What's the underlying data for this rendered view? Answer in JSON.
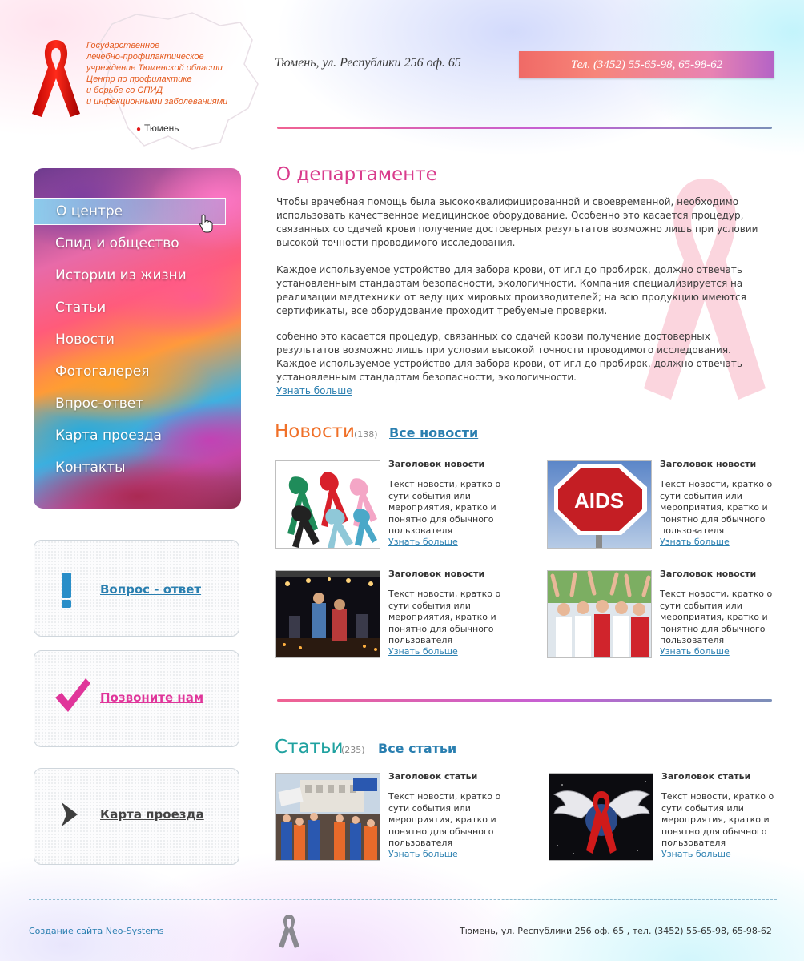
{
  "header": {
    "org_name": "Государственное\nлечебно-профилактическое\nучреждение Тюменской области\nЦентр по профилактике\nи борьбе  со СПИД\nи инфекционными заболеваниями",
    "city": "Тюмень",
    "address": "Тюмень, ул. Республики 256 оф. 65",
    "phone": "Тел. (3452) 55-65-98, 65-98-62"
  },
  "menu": {
    "items": [
      {
        "label": "О центре",
        "active": true
      },
      {
        "label": "Спид и общество"
      },
      {
        "label": "Истории из жизни"
      },
      {
        "label": "Статьи"
      },
      {
        "label": "Новости"
      },
      {
        "label": "Фотогалерея"
      },
      {
        "label": "Впрос-ответ"
      },
      {
        "label": "Карта проезда"
      },
      {
        "label": "Контакты"
      }
    ]
  },
  "side_boxes": [
    {
      "label": "Вопрос - ответ",
      "icon": "exclamation-icon",
      "color": "#2a7fb0"
    },
    {
      "label": "Позвоните нам",
      "icon": "checkmark-icon",
      "color": "#e0359a"
    },
    {
      "label": "Карта проезда",
      "icon": "chevron-right-icon",
      "color": "#444444"
    }
  ],
  "main": {
    "title": "О департаменте",
    "paragraphs": [
      "Чтобы врачебная помощь была высококвалифицированной и своевременной, необходимо использовать качественное медицинское оборудование. Особенно это касается процедур, связанных со сдачей крови получение достоверных результатов возможно лишь при условии высокой точности проводимого исследования.",
      "Каждое используемое устройство для забора крови, от игл до пробирок, должно отвечать установленным стандартам безопасности, экологичности. Компания специализируется на реализации медтехники от ведущих мировых производителей; на всю продукцию имеются сертификаты, все оборудование проходит требуемые проверки.",
      "собенно это касается процедур, связанных со сдачей крови получение достоверных результатов возможно лишь при условии высокой точности проводимого исследования. Каждое используемое устройство для забора крови, от игл до пробирок, должно отвечать установленным стандартам безопасности, экологичности."
    ],
    "more_link": "Узнать больше"
  },
  "news": {
    "title": "Новости",
    "count": "(138)",
    "all_link": "Все новости",
    "items": [
      {
        "title": "Заголовок новости",
        "text": "Текст новости, кратко о\nсути события или\nмероприятия, кратко и\nпонятно для обычного\nпользователя",
        "more": "Узнать больше",
        "image": "ribbons"
      },
      {
        "title": "Заголовок новости",
        "text": "Текст новости, кратко о\nсути события или\nмероприятия, кратко и\nпонятно для обычного\nпользователя",
        "more": "Узнать больше",
        "image": "aids-sign",
        "image_text": "AIDS"
      },
      {
        "title": "Заголовок новости",
        "text": "Текст новости, кратко о\nсути события или\nмероприятия, кратко и\nпонятно для обычного\nпользователя",
        "more": "Узнать больше",
        "image": "concert"
      },
      {
        "title": "Заголовок новости",
        "text": "Текст новости, кратко о\nсути события или\nмероприятия, кратко и\nпонятно для обычного\nпользователя",
        "more": "Узнать больше",
        "image": "crowd"
      }
    ]
  },
  "articles": {
    "title": "Статьи",
    "count": "(235)",
    "all_link": "Все статьи",
    "items": [
      {
        "title": "Заголовок статьи",
        "text": "Текст новости, кратко о\nсути события или\nмероприятия, кратко и\nпонятно для обычного\nпользователя",
        "more": "Узнать больше",
        "image": "rally"
      },
      {
        "title": "Заголовок статьи",
        "text": "Текст новости, кратко о\nсути события или\nмероприятия, кратко и\nпонятно для обычного\nпользователя",
        "more": "Узнать больше",
        "image": "winged-ribbon"
      }
    ]
  },
  "footer": {
    "credit": "Создание сайта Neo-Systems",
    "address": "Тюмень, ул. Республики 256 оф. 65 , тел. (3452) 55-65-98, 65-98-62"
  },
  "colors": {
    "accent_pink": "#d93b8c",
    "news_orange": "#f07028",
    "articles_teal": "#20a2a0",
    "link_blue": "#2a7fb0"
  }
}
